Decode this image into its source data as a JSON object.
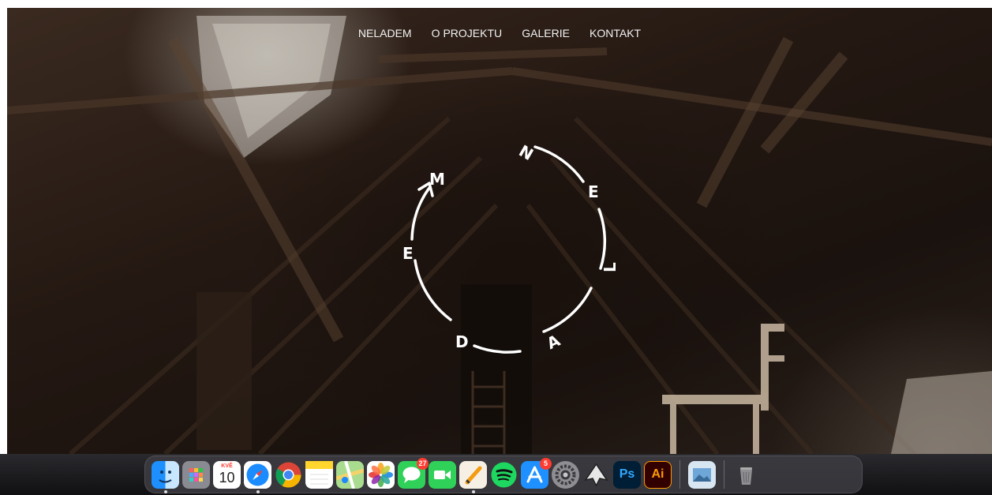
{
  "nav": {
    "items": [
      "NELADEM",
      "O PROJEKTU",
      "GALERIE",
      "KONTAKT"
    ]
  },
  "logo": {
    "letters": [
      "N",
      "E",
      "L",
      "A",
      "D",
      "E",
      "M"
    ],
    "color": "#ffffff"
  },
  "dock": {
    "apps": [
      {
        "name": "Finder",
        "icon": "finder-icon"
      },
      {
        "name": "Launchpad",
        "icon": "launchpad-icon"
      },
      {
        "name": "Calendar",
        "icon": "calendar-icon",
        "month": "KVĚ",
        "day": "10"
      },
      {
        "name": "Safari",
        "icon": "safari-icon"
      },
      {
        "name": "Chrome",
        "icon": "chrome-icon"
      },
      {
        "name": "Notes",
        "icon": "notes-icon"
      },
      {
        "name": "Maps",
        "icon": "maps-icon"
      },
      {
        "name": "Photos",
        "icon": "photos-icon"
      },
      {
        "name": "Messages",
        "icon": "messages-icon",
        "badge": "27"
      },
      {
        "name": "FaceTime",
        "icon": "facetime-icon"
      },
      {
        "name": "Pages",
        "icon": "pages-icon"
      },
      {
        "name": "Spotify",
        "icon": "spotify-icon"
      },
      {
        "name": "App Store",
        "icon": "app-store-icon",
        "badge": "5"
      },
      {
        "name": "System Preferences",
        "icon": "system-preferences-icon"
      },
      {
        "name": "Inkscape",
        "icon": "inkscape-icon"
      },
      {
        "name": "Photoshop",
        "icon": "photoshop-icon",
        "label": "Ps"
      },
      {
        "name": "Illustrator",
        "icon": "illustrator-icon",
        "label": "Ai"
      },
      {
        "name": "Preview",
        "icon": "preview-icon"
      },
      {
        "name": "Trash",
        "icon": "trash-icon"
      }
    ]
  }
}
